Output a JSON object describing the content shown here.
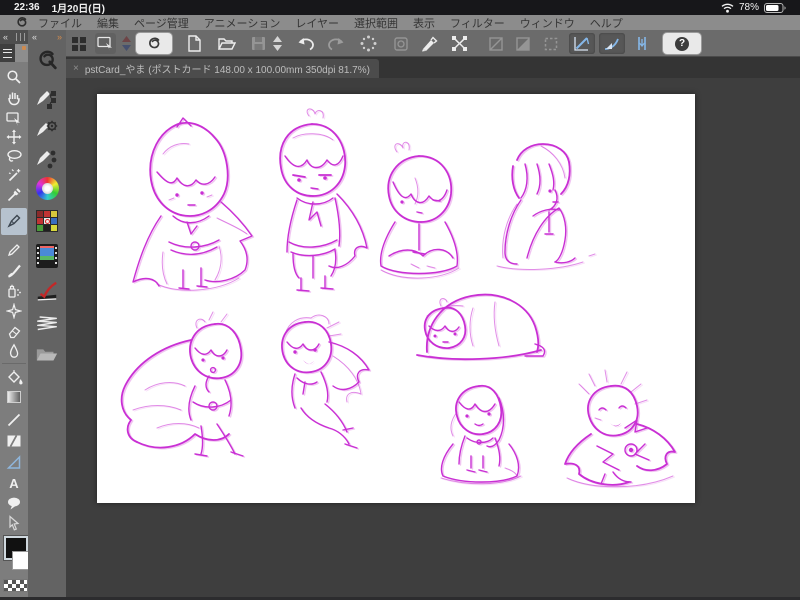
{
  "status_bar": {
    "time": "22:36",
    "date": "1月20日(日)",
    "battery_percent": "78%",
    "icons": [
      "wifi-icon",
      "battery-icon"
    ]
  },
  "menu_bar": {
    "logo_icon": "clip-studio-logo",
    "items": [
      "ファイル",
      "編集",
      "ページ管理",
      "アニメーション",
      "レイヤー",
      "選択範囲",
      "表示",
      "フィルター",
      "ウィンドウ",
      "ヘルプ"
    ]
  },
  "main_toolbar": {
    "buttons": [
      "app-grid",
      "screen-settings",
      "stepper-up-down",
      "clip-studio-launcher",
      "new-file",
      "open-file",
      "save-disabled",
      "stepper-up-down-2",
      "undo",
      "redo-disabled",
      "gesture-dots",
      "filter-disabled",
      "blend-touch",
      "mesh-transform",
      "layer-op-disabled-1",
      "layer-op-disabled-2",
      "layer-op-disabled-3",
      "snap-to-ruler",
      "snap-to-special-ruler",
      "snap-to-grid",
      "help"
    ],
    "help_glyph": "?"
  },
  "document_tab": {
    "close_glyph": "×",
    "title": "pstCard_やま (ポストカード 148.00 x 100.00mm 350dpi 81.7%)"
  },
  "tool_column": {
    "collapse_glyph": "«",
    "tools": [
      "zoom",
      "hand",
      "navigate",
      "move",
      "lasso",
      "magic-wand",
      "eyedropper",
      "pen",
      "pencil",
      "brush",
      "airbrush",
      "decoration",
      "eraser",
      "blend",
      "fill-bucket",
      "gradient",
      "line",
      "frame-border",
      "ruler",
      "text",
      "balloon",
      "object"
    ],
    "selected_tool": "pen",
    "text_tool_glyph": "A",
    "swatches": {
      "foreground": "#111111",
      "background": "#ffffff",
      "transparent": "checker"
    }
  },
  "quick_access": {
    "collapse_glyph": "«",
    "expand_glyph": "»",
    "icons": [
      "clip-studio-q-logo",
      "subtool-squares",
      "subtool-gear",
      "subtool-dots",
      "color-wheel",
      "color-set-palette",
      "animation-film",
      "brush-check",
      "spring-3d",
      "material-folder"
    ]
  },
  "canvas": {
    "paper_color": "#ffffff",
    "ink_color": "#c92fd4",
    "zoom_percent": "81.7%",
    "sketches": [
      "hooded-chibi-standing",
      "caped-chibi-standing",
      "hooded-chibi-sitting-crosslegged",
      "chibi-sitting-knees-up",
      "chibi-diving-with-cape",
      "chibi-jumping-with-cape",
      "chibi-sleeping-under-blanket",
      "chibi-kneeling",
      "chibi-sitting-dramatic-cloak"
    ]
  },
  "colors": {
    "menu_bg": "#8c8c8c",
    "toolbar_bg": "#6b6b6b",
    "pasteboard": "#3e3e3e",
    "selected_tool_bg": "#b6c2ce",
    "snap_icon_blue": "#85b7e8",
    "accent_orange": "#cf8a4e"
  }
}
